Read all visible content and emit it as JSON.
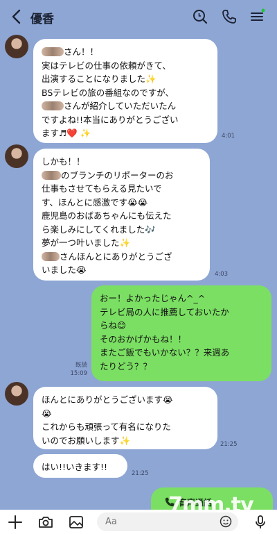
{
  "header": {
    "title": "優香"
  },
  "messages": [
    {
      "dir": "in",
      "lines": [
        "さん！！",
        "実はテレビの仕事の依頼がきて、",
        "出演することになりました✨",
        "BSテレビの旅の番組なのですが、",
        "さんが紹介していただいたん",
        "ですよね!!本当にありがとうござい",
        "ます♬❤️ ✨"
      ],
      "time": "4:01"
    },
    {
      "dir": "in",
      "lines": [
        "しかも！！",
        "のブランチのリポーターのお",
        "仕事もさせてもらえる見たいで",
        "す、ほんとに感激です😭😭",
        "鹿児島のおばあちゃんにも伝えた",
        "ら楽しみにしてくれました🎶",
        "夢が一つ叶いました✨",
        "さんほんとにありがとうござ",
        "いました😭"
      ],
      "time": "4:03"
    },
    {
      "dir": "out",
      "lines": [
        "おー！よかったじゃん^_^",
        "テレビ局の人に推薦しておいたか",
        "らね😊",
        "そのおかげかもね！！",
        "またご飯でもいかない？？来週あ",
        "たりどう？？"
      ],
      "read": "既読",
      "time": "15:09"
    },
    {
      "dir": "in",
      "lines": [
        "ほんとにありがとうございます😭",
        "😭",
        "これからも頑張って有名になりた",
        "いのでお願いします✨"
      ],
      "time": "21:25"
    },
    {
      "dir": "in",
      "lines": [
        "はい!!いきます!!"
      ],
      "time": "21:25"
    },
    {
      "dir": "out",
      "lines": [
        "音声通話"
      ]
    }
  ],
  "watermark": "7mm.tv",
  "composer": {
    "placeholder": "Aa"
  },
  "colors": {
    "background": "#8ea6d4",
    "incoming": "#ffffff",
    "outgoing": "#7bdf63"
  }
}
